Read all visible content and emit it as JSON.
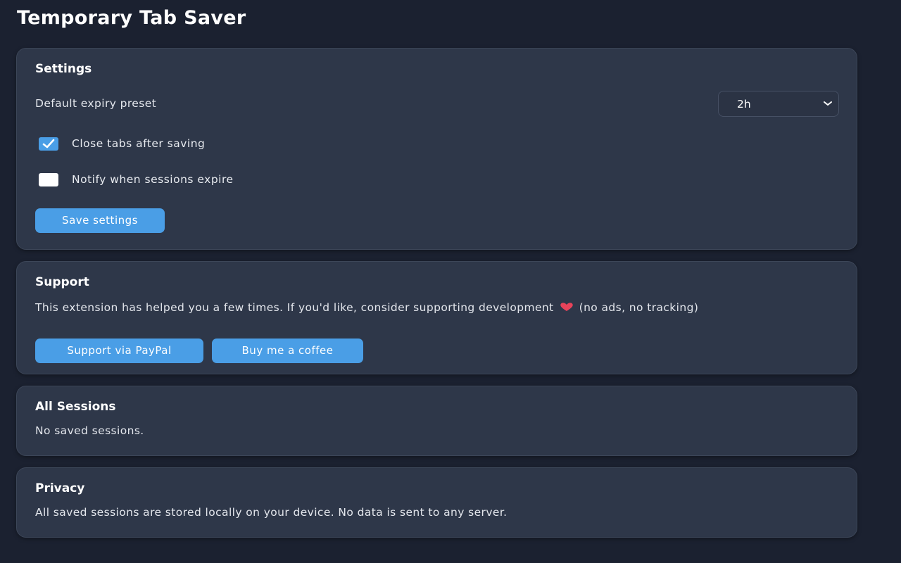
{
  "app": {
    "title": "Temporary Tab Saver"
  },
  "settings": {
    "heading": "Settings",
    "expiry_label": "Default expiry preset",
    "expiry_value": "2h",
    "close_tabs_label": "Close tabs after saving",
    "close_tabs_checked": true,
    "notify_label": "Notify when sessions expire",
    "notify_checked": false,
    "save_button_label": "Save settings"
  },
  "support": {
    "heading": "Support",
    "message_before": "This extension has helped you a few times. If you'd like, consider supporting development",
    "message_after": "(no ads, no tracking)",
    "heart_icon": "heart-icon",
    "paypal_button_label": "Support via PayPal",
    "coffee_button_label": "Buy me a coffee"
  },
  "sessions": {
    "heading": "All Sessions",
    "empty_text": "No saved sessions."
  },
  "privacy": {
    "heading": "Privacy",
    "text": "All saved sessions are stored locally on your device. No data is sent to any server."
  },
  "colors": {
    "background": "#1b2130",
    "card": "#2e3749",
    "accent": "#4a9ee6",
    "heart": "#e8435a"
  }
}
